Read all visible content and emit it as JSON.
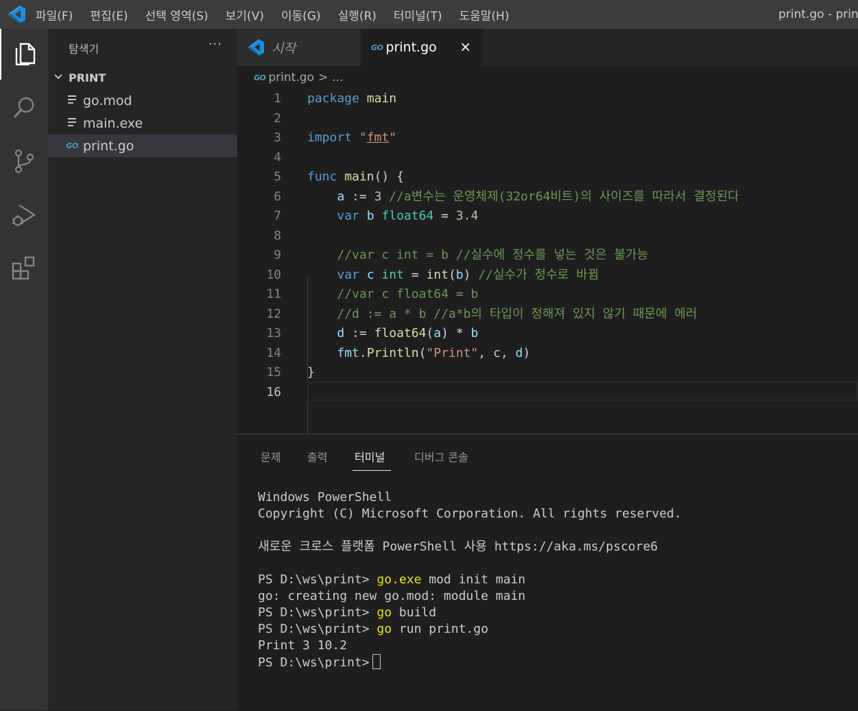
{
  "menu": {
    "items": [
      "파일(F)",
      "편집(E)",
      "선택 영역(S)",
      "보기(V)",
      "이동(G)",
      "실행(R)",
      "터미널(T)",
      "도움말(H)"
    ]
  },
  "window": {
    "title": "print.go - print"
  },
  "activity_bar": {
    "icons": [
      "explorer-icon",
      "search-icon",
      "source-control-icon",
      "run-debug-icon",
      "extensions-icon"
    ]
  },
  "sidebar": {
    "title": "탐색기",
    "more": "···",
    "folder": "PRINT",
    "files": [
      {
        "name": "go.mod",
        "icon": "file-lines-icon"
      },
      {
        "name": "main.exe",
        "icon": "file-lines-icon"
      },
      {
        "name": "print.go",
        "icon": "go-icon"
      }
    ]
  },
  "tabs": [
    {
      "label": "시작",
      "icon": "vscode-icon"
    },
    {
      "label": "print.go",
      "icon": "go-icon",
      "close": "×"
    }
  ],
  "go_badge": "GO",
  "breadcrumb": {
    "file": "print.go",
    "sep": ">",
    "rest": "..."
  },
  "editor": {
    "lines": [
      {
        "n": "1",
        "t": [
          [
            "kw",
            "package"
          ],
          [
            "pl",
            " "
          ],
          [
            "fn",
            "main"
          ]
        ]
      },
      {
        "n": "2",
        "t": []
      },
      {
        "n": "3",
        "t": [
          [
            "kw",
            "import"
          ],
          [
            "pl",
            " "
          ],
          [
            "str",
            "\""
          ],
          [
            "str squig",
            "fmt"
          ],
          [
            "str",
            "\""
          ]
        ]
      },
      {
        "n": "4",
        "t": []
      },
      {
        "n": "5",
        "t": [
          [
            "kw",
            "func"
          ],
          [
            "pl",
            " "
          ],
          [
            "fn",
            "main"
          ],
          [
            "pl",
            "() {"
          ]
        ]
      },
      {
        "n": "6",
        "t": [
          [
            "pl",
            "    "
          ],
          [
            "va",
            "a"
          ],
          [
            "pl",
            " := "
          ],
          [
            "num",
            "3"
          ],
          [
            "pl",
            " "
          ],
          [
            "cm",
            "//a변수는 운영체제(32or64비트)의 사이즈를 따라서 결정된다"
          ]
        ]
      },
      {
        "n": "7",
        "t": [
          [
            "pl",
            "    "
          ],
          [
            "kw",
            "var"
          ],
          [
            "pl",
            " "
          ],
          [
            "va",
            "b"
          ],
          [
            "pl",
            " "
          ],
          [
            "ty",
            "float64"
          ],
          [
            "pl",
            " = "
          ],
          [
            "num",
            "3.4"
          ]
        ]
      },
      {
        "n": "8",
        "t": []
      },
      {
        "n": "9",
        "t": [
          [
            "pl",
            "    "
          ],
          [
            "cm",
            "//var c int = b //실수에 정수를 넣는 것은 불가능"
          ]
        ]
      },
      {
        "n": "10",
        "t": [
          [
            "pl",
            "    "
          ],
          [
            "kw",
            "var"
          ],
          [
            "pl",
            " "
          ],
          [
            "va",
            "c"
          ],
          [
            "pl",
            " "
          ],
          [
            "ty",
            "int"
          ],
          [
            "pl",
            " = "
          ],
          [
            "fn",
            "int"
          ],
          [
            "pl",
            "("
          ],
          [
            "va",
            "b"
          ],
          [
            "pl",
            ") "
          ],
          [
            "cm",
            "//실수가 정수로 바뀜"
          ]
        ]
      },
      {
        "n": "11",
        "t": [
          [
            "pl",
            "    "
          ],
          [
            "cm",
            "//var c float64 = b"
          ]
        ]
      },
      {
        "n": "12",
        "t": [
          [
            "pl",
            "    "
          ],
          [
            "cm",
            "//d := a * b //a*b의 타입이 정해져 있지 않기 때문에 에러"
          ]
        ]
      },
      {
        "n": "13",
        "t": [
          [
            "pl",
            "    "
          ],
          [
            "va",
            "d"
          ],
          [
            "pl",
            " := "
          ],
          [
            "fn",
            "float64"
          ],
          [
            "pl",
            "("
          ],
          [
            "va",
            "a"
          ],
          [
            "pl",
            ") * "
          ],
          [
            "va",
            "b"
          ]
        ]
      },
      {
        "n": "14",
        "t": [
          [
            "pl",
            "    "
          ],
          [
            "va",
            "fmt"
          ],
          [
            "pl",
            "."
          ],
          [
            "fn",
            "Println"
          ],
          [
            "pl",
            "("
          ],
          [
            "str",
            "\"Print\""
          ],
          [
            "pl",
            ", "
          ],
          [
            "va",
            "c"
          ],
          [
            "pl",
            ", "
          ],
          [
            "va",
            "d"
          ],
          [
            "pl",
            ")"
          ]
        ]
      },
      {
        "n": "15",
        "t": [
          [
            "pl",
            "}"
          ]
        ]
      },
      {
        "n": "16",
        "t": []
      }
    ]
  },
  "panel": {
    "tabs": [
      "문제",
      "출력",
      "터미널",
      "디버그 콘솔"
    ],
    "active_tab": "터미널",
    "terminal": [
      [
        [
          "",
          "Windows PowerShell"
        ]
      ],
      [
        [
          "",
          "Copyright (C) Microsoft Corporation. All rights reserved."
        ]
      ],
      [
        [
          "",
          ""
        ]
      ],
      [
        [
          "",
          "새로운 크로스 플랫폼 PowerShell 사용 https://aka.ms/pscore6"
        ]
      ],
      [
        [
          "",
          ""
        ]
      ],
      [
        [
          "",
          "PS D:\\ws\\print> "
        ],
        [
          "yl",
          "go.exe"
        ],
        [
          "",
          " mod init main"
        ]
      ],
      [
        [
          "",
          "go: creating new go.mod: module main"
        ]
      ],
      [
        [
          "",
          "PS D:\\ws\\print> "
        ],
        [
          "yl",
          "go"
        ],
        [
          "",
          " build"
        ]
      ],
      [
        [
          "",
          "PS D:\\ws\\print> "
        ],
        [
          "yl",
          "go"
        ],
        [
          "",
          " run print.go"
        ]
      ],
      [
        [
          "",
          "Print 3 10.2"
        ]
      ],
      [
        [
          "",
          "PS D:\\ws\\print>"
        ]
      ]
    ]
  }
}
